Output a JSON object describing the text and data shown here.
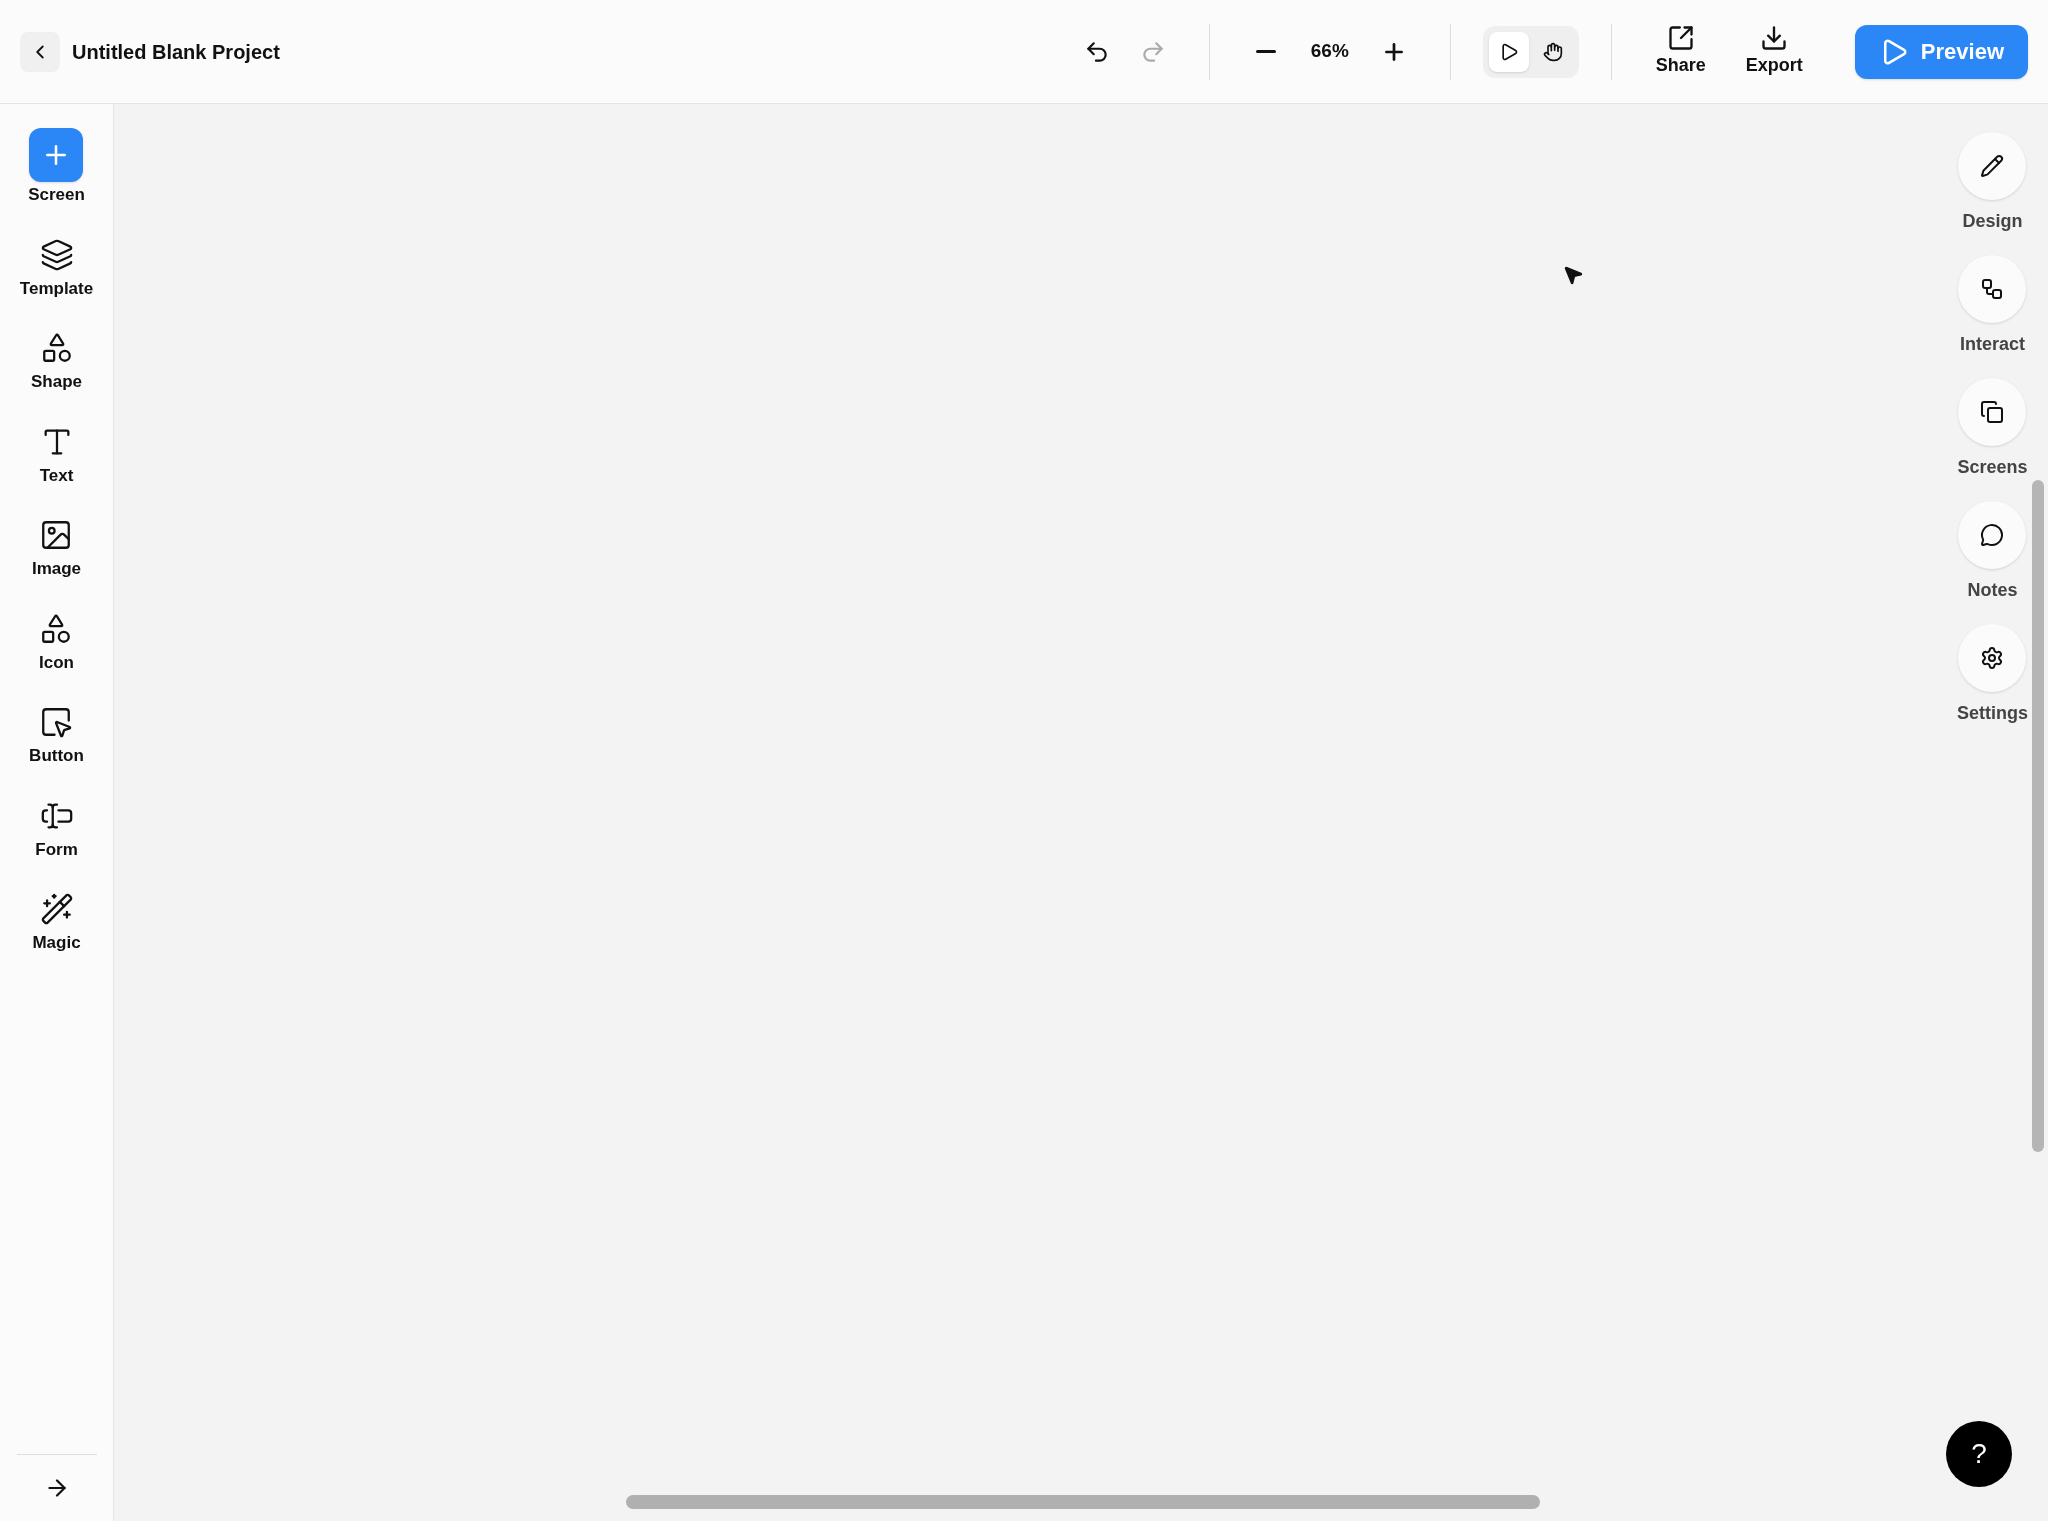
{
  "project": {
    "title": "Untitled Blank Project"
  },
  "history": {
    "undo_disabled": false,
    "redo_disabled": true
  },
  "zoom": {
    "value": "66%"
  },
  "modes": [
    {
      "kind": "pointer",
      "selected": true
    },
    {
      "kind": "hand",
      "selected": false
    }
  ],
  "actions": [
    {
      "label": "Share"
    },
    {
      "label": "Export"
    }
  ],
  "preview": {
    "label": "Preview"
  },
  "left_tools": [
    {
      "label": "Screen",
      "kind": "primary"
    },
    {
      "label": "Template",
      "kind": "tool"
    },
    {
      "label": "Shape",
      "kind": "tool"
    },
    {
      "label": "Text",
      "kind": "tool"
    },
    {
      "label": "Image",
      "kind": "tool"
    },
    {
      "label": "Icon",
      "kind": "tool"
    },
    {
      "label": "Button",
      "kind": "tool"
    },
    {
      "label": "Form",
      "kind": "tool"
    },
    {
      "label": "Magic",
      "kind": "tool"
    }
  ],
  "right_panels": [
    {
      "label": "Design"
    },
    {
      "label": "Interact"
    },
    {
      "label": "Screens"
    },
    {
      "label": "Notes"
    },
    {
      "label": "Settings"
    }
  ],
  "help": {
    "label": "?"
  }
}
